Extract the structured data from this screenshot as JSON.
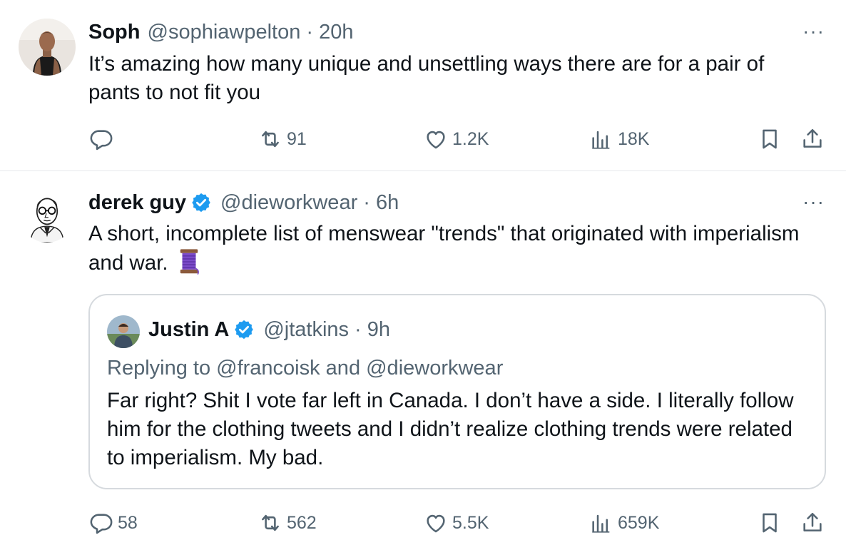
{
  "tweets": [
    {
      "name": "Soph",
      "handle": "@sophiawpelton",
      "time": "· 20h",
      "verified": false,
      "more": "···",
      "text": "It’s amazing how many unique and unsettling ways there are for a pair of pants to not fit you",
      "actions": {
        "replies": "",
        "retweets": "91",
        "likes": "1.2K",
        "views": "18K"
      },
      "avatar_icon": "profile-photo"
    },
    {
      "name": "derek guy",
      "handle": "@dieworkwear",
      "time": "· 6h",
      "verified": true,
      "more": "···",
      "text": "A short, incomplete list of menswear \"trends\" that originated with imperialism and war.",
      "emoji": "thread-spool-emoji",
      "actions": {
        "replies": "58",
        "retweets": "562",
        "likes": "5.5K",
        "views": "659K"
      },
      "avatar_icon": "sketch-portrait",
      "quote": {
        "name": "Justin A",
        "handle": "@jtatkins",
        "time": "· 9h",
        "verified": true,
        "replying": "Replying to @francoisk and @dieworkwear",
        "text": "Far right? Shit I vote far left in Canada. I don’t have a side.  I literally follow him for the clothing tweets and I didn’t realize clothing trends were related to imperialism. My bad."
      }
    }
  ],
  "colors": {
    "text": "#0f1419",
    "secondary": "#536471",
    "verified": "#1d9bf0",
    "border": "#e6e9ec"
  }
}
